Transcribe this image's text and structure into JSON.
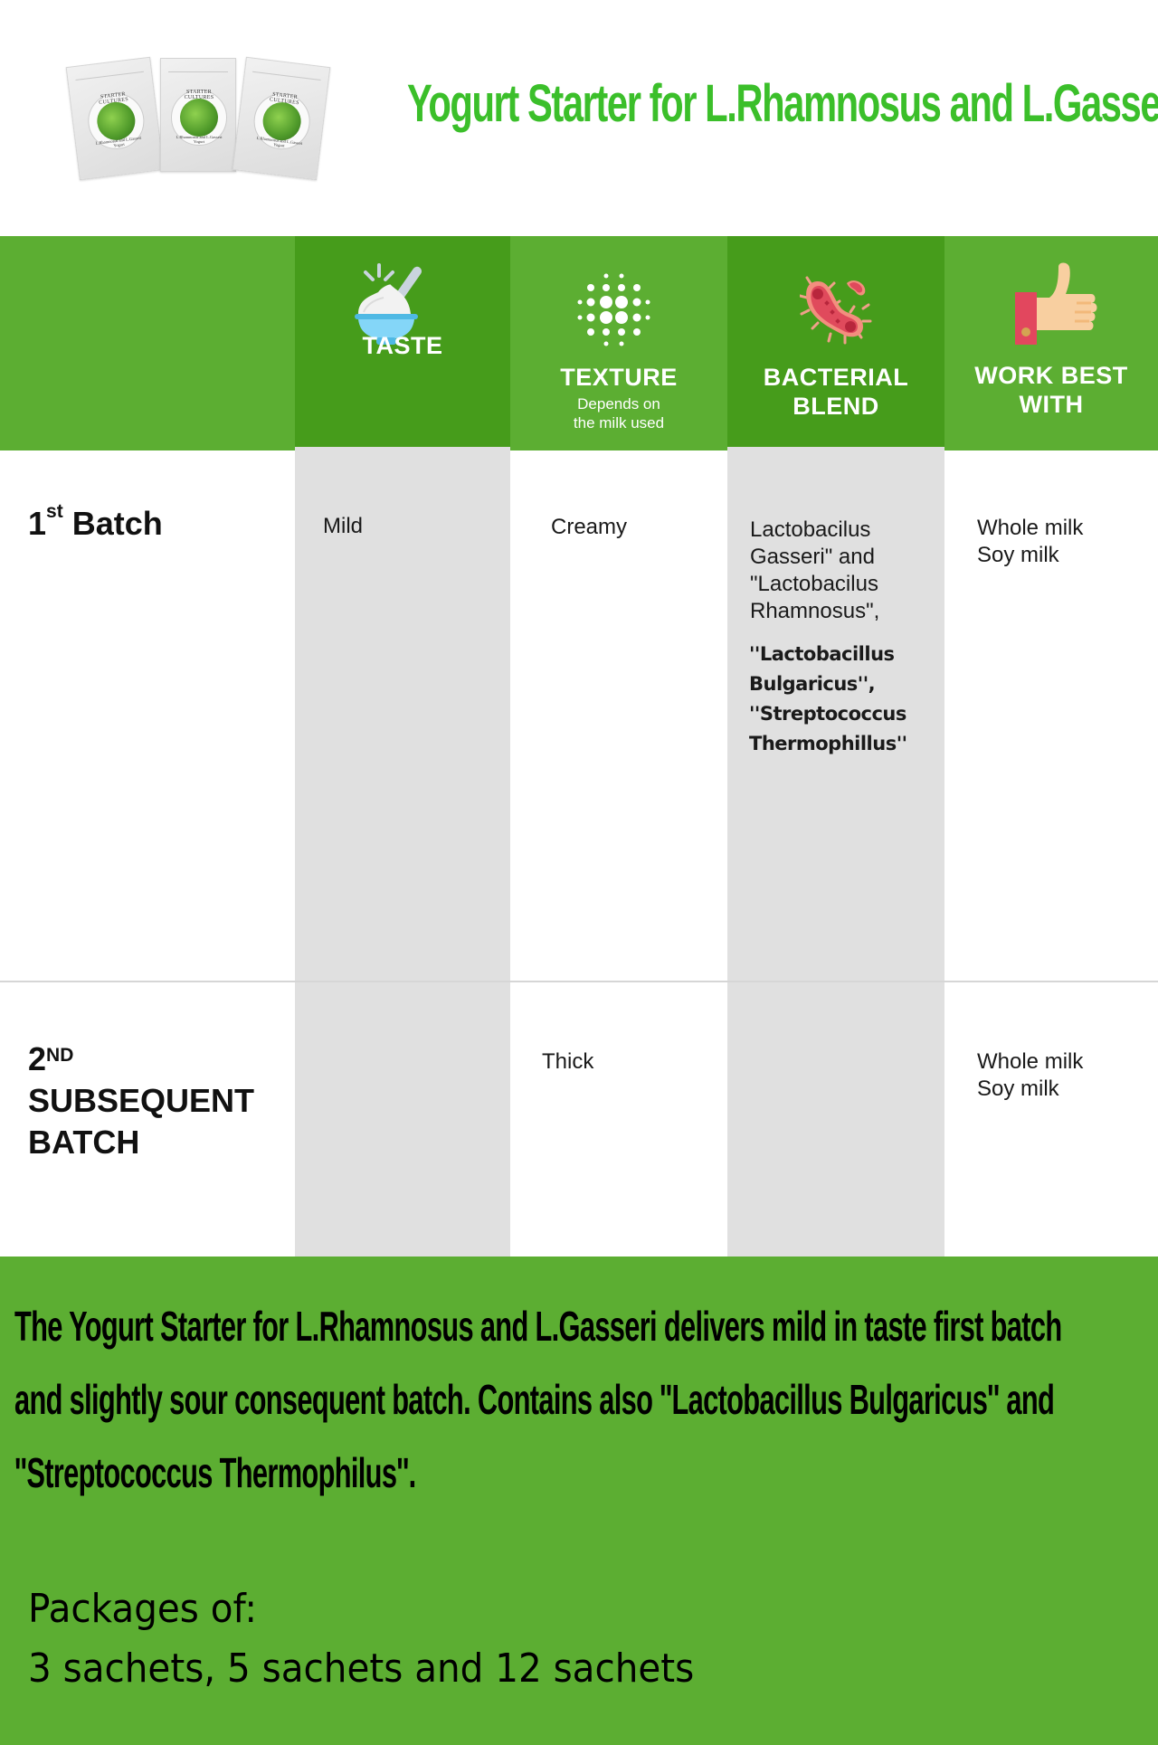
{
  "header": {
    "title": "Yogurt Starter for L.Rhamnosus and L.Gasseri Yogurt",
    "product_image": {
      "sachet_count": 3,
      "sachet_label_top": "STARTER CULTURES",
      "sachet_label_bottom": "L.Rhamnosus and L.Gasseri Yogurt"
    }
  },
  "columns": [
    {
      "key": "taste",
      "label": "TASTE",
      "sublabel": "",
      "icon": "yogurt-bowl-icon"
    },
    {
      "key": "texture",
      "label": "TEXTURE",
      "sublabel_line1": "Depends on",
      "sublabel_line2": "the milk used",
      "icon": "texture-dots-icon"
    },
    {
      "key": "bacterial_blend",
      "label_line1": "BACTERIAL",
      "label_line2": "BLEND",
      "icon": "bacteria-icon"
    },
    {
      "key": "work_best_with",
      "label_line1": "WORK BEST",
      "label_line2": "WITH",
      "icon": "thumbs-up-icon"
    }
  ],
  "rows": [
    {
      "label_main": "1",
      "label_sup": "st",
      "label_rest": " Batch",
      "taste": "Mild",
      "texture": "Creamy",
      "bacterial_blend": {
        "regular_lines": [
          "Lactobacilus",
          "Gasseri\" and",
          "\"Lactobacilus",
          "Rhamnosus\","
        ],
        "bold_lines": [
          "''Lactobacillus",
          "Bulgaricus'',",
          "''Streptococcus",
          "Thermophillus''"
        ]
      },
      "work_best_with": [
        "Whole milk",
        "Soy milk"
      ]
    },
    {
      "label_main": "2",
      "label_sup": "ND",
      "label_line2": "SUBSEQUENT",
      "label_line3": "BATCH",
      "taste": "",
      "texture": "Thick",
      "bacterial_blend": "",
      "work_best_with": [
        "Whole milk",
        "Soy milk"
      ]
    }
  ],
  "footer": {
    "summary_lines": [
      "The Yogurt Starter for L.Rhamnosus and L.Gasseri delivers mild in taste first batch",
      "and slightly sour consequent batch. Contains also ''Lactobacillus Bulgaricus'' and",
      "''Streptococcus Thermophilus''."
    ],
    "packages_label": "Packages of:",
    "packages_value": "3 sachets, 5 sachets and 12 sachets"
  },
  "colors": {
    "title_green": "#3bbf2a",
    "band_green": "#5cae32",
    "dark_green": "#469c1b",
    "column_gray": "#e0e0e0"
  }
}
